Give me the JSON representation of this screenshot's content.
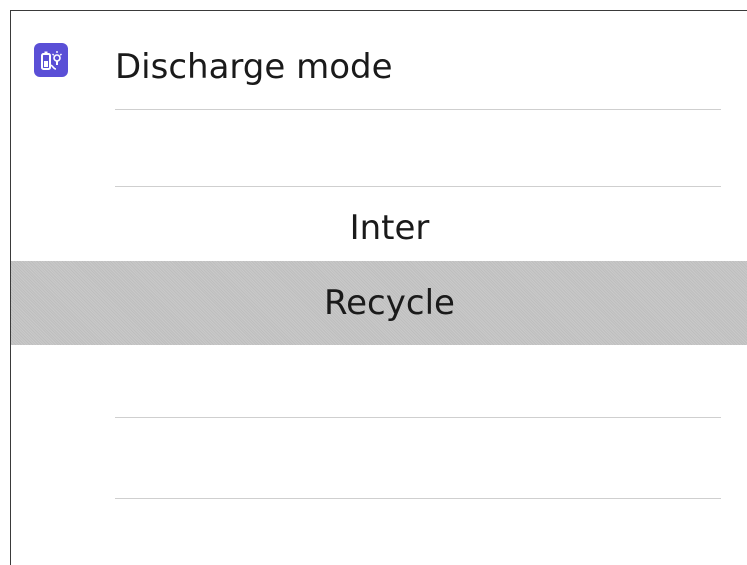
{
  "header": {
    "icon": "battery-bulb-icon",
    "title": "Discharge mode"
  },
  "picker": {
    "options": [
      {
        "label": ""
      },
      {
        "label": "Inter"
      },
      {
        "label": "Recycle",
        "selected": true
      },
      {
        "label": ""
      },
      {
        "label": ""
      }
    ]
  },
  "colors": {
    "accent": "#5a4fd6",
    "selected_row": "#c6c6c6",
    "separator": "#cfcfcf"
  }
}
